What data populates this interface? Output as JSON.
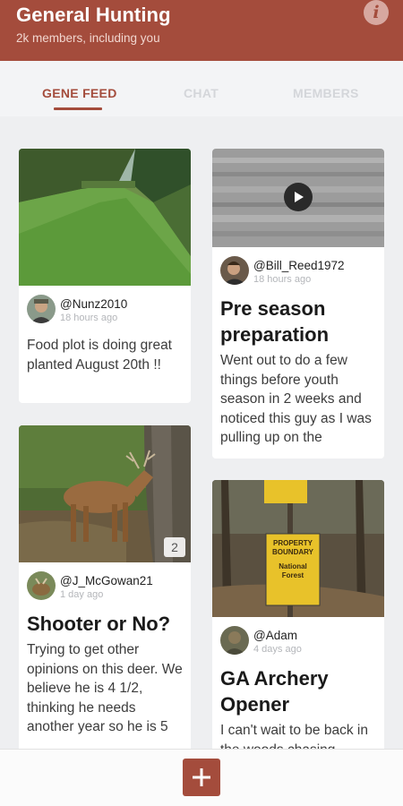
{
  "header": {
    "title": "General Hunting",
    "subtitle": "2k members, including you",
    "info_icon": "info-icon"
  },
  "tabs": [
    {
      "label": "GENE FEED",
      "active": true
    },
    {
      "label": "CHAT",
      "active": false
    },
    {
      "label": "MEMBERS",
      "active": false
    }
  ],
  "colors": {
    "brand": "#a44c3c",
    "background": "#eeeff1"
  },
  "posts": [
    {
      "author": "@Nunz2010",
      "time": "18 hours ago",
      "body": "Food plot is doing great planted August 20th !!"
    },
    {
      "author": "@Bill_Reed1972",
      "time": "18 hours ago",
      "title": "Pre season preparation",
      "body": "Went out to do a few things before youth season in 2 weeks and noticed this guy as I was pulling up on the",
      "media_icon": "play-icon"
    },
    {
      "author": "@J_McGowan21",
      "time": "1 day ago",
      "title": "Shooter or No?",
      "body": "Trying to get other opinions on this deer. We believe he is 4 1/2, thinking he needs another year so he is 5",
      "photo_count": "2"
    },
    {
      "author": "@Adam",
      "time": "4 days ago",
      "title": "GA Archery Opener",
      "body": "I can't wait to be back in the woods chasing",
      "sign_text": [
        "PROPERTY",
        "BOUNDARY",
        "National",
        "Forest"
      ]
    }
  ],
  "bottom_bar": {
    "add_icon": "plus-icon"
  }
}
